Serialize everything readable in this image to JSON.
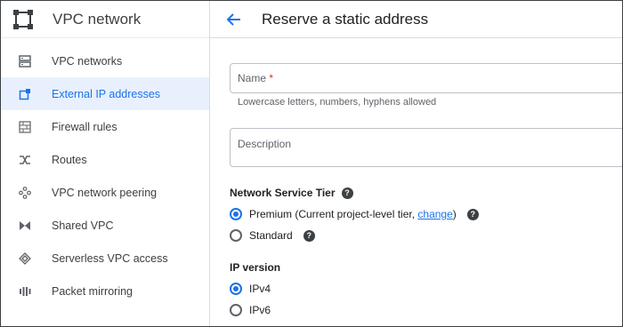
{
  "sidebar": {
    "title": "VPC network",
    "items": [
      {
        "label": "VPC networks",
        "icon": "vpc-networks-icon"
      },
      {
        "label": "External IP addresses",
        "icon": "external-ip-icon"
      },
      {
        "label": "Firewall rules",
        "icon": "firewall-icon"
      },
      {
        "label": "Routes",
        "icon": "routes-icon"
      },
      {
        "label": "VPC network peering",
        "icon": "peering-icon"
      },
      {
        "label": "Shared VPC",
        "icon": "shared-vpc-icon"
      },
      {
        "label": "Serverless VPC access",
        "icon": "serverless-icon"
      },
      {
        "label": "Packet mirroring",
        "icon": "packet-mirroring-icon"
      }
    ],
    "active_index": 1
  },
  "header": {
    "title": "Reserve a static address"
  },
  "form": {
    "name_label": "Name",
    "name_required_mark": "*",
    "name_value": "",
    "name_hint": "Lowercase letters, numbers, hyphens allowed",
    "description_label": "Description",
    "description_value": "",
    "tier": {
      "label": "Network Service Tier",
      "premium_label": "Premium (Current project-level tier, ",
      "premium_link": "change",
      "premium_suffix": ")",
      "standard_label": "Standard",
      "selected": "Premium"
    },
    "ip_version": {
      "label": "IP version",
      "ipv4_label": "IPv4",
      "ipv6_label": "IPv6",
      "selected": "IPv4"
    }
  },
  "colors": {
    "accent": "#1a73e8",
    "active_bg": "#e8f0fe",
    "required": "#d93025"
  }
}
